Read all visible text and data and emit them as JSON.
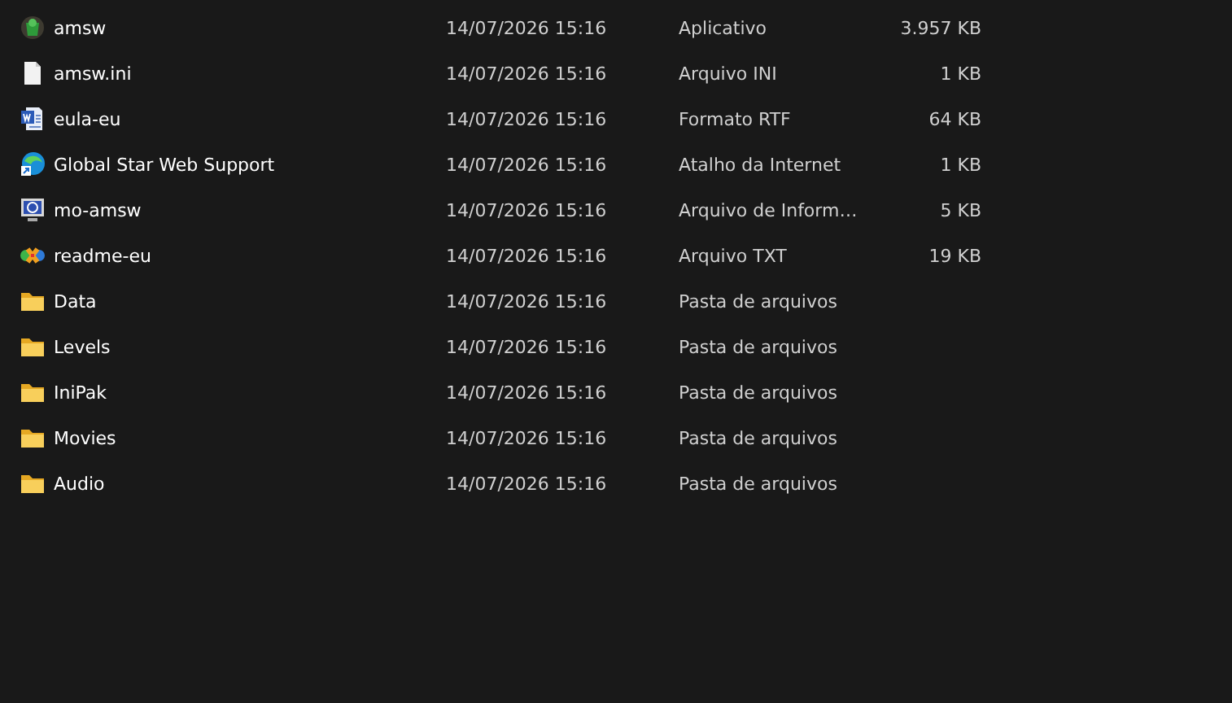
{
  "files": [
    {
      "kind": "app",
      "name": "amsw",
      "modified": "14/07/2026 15:16",
      "type": "Aplicativo",
      "size": "3.957 KB"
    },
    {
      "kind": "blank",
      "name": "amsw.ini",
      "modified": "14/07/2026 15:16",
      "type": "Arquivo INI",
      "size": "1 KB"
    },
    {
      "kind": "word",
      "name": "eula-eu",
      "modified": "14/07/2026 15:16",
      "type": "Formato RTF",
      "size": "64 KB"
    },
    {
      "kind": "shortcut",
      "name": "Global Star Web Support",
      "modified": "14/07/2026 15:16",
      "type": "Atalho da Internet",
      "size": "1 KB"
    },
    {
      "kind": "info",
      "name": "mo-amsw",
      "modified": "14/07/2026 15:16",
      "type": "Arquivo de Inform…",
      "size": "5 KB"
    },
    {
      "kind": "text",
      "name": "readme-eu",
      "modified": "14/07/2026 15:16",
      "type": "Arquivo TXT",
      "size": "19 KB"
    },
    {
      "kind": "folder",
      "name": "Data",
      "modified": "14/07/2026 15:16",
      "type": "Pasta de arquivos"
    },
    {
      "kind": "folder",
      "name": "Levels",
      "modified": "14/07/2026 15:16",
      "type": "Pasta de arquivos"
    },
    {
      "kind": "folder",
      "name": "IniPak",
      "modified": "14/07/2026 15:16",
      "type": "Pasta de arquivos"
    },
    {
      "kind": "folder",
      "name": "Movies",
      "modified": "14/07/2026 15:16",
      "type": "Pasta de arquivos"
    },
    {
      "kind": "folder",
      "name": "Audio",
      "modified": "14/07/2026 15:16",
      "type": "Pasta de arquivos"
    }
  ]
}
